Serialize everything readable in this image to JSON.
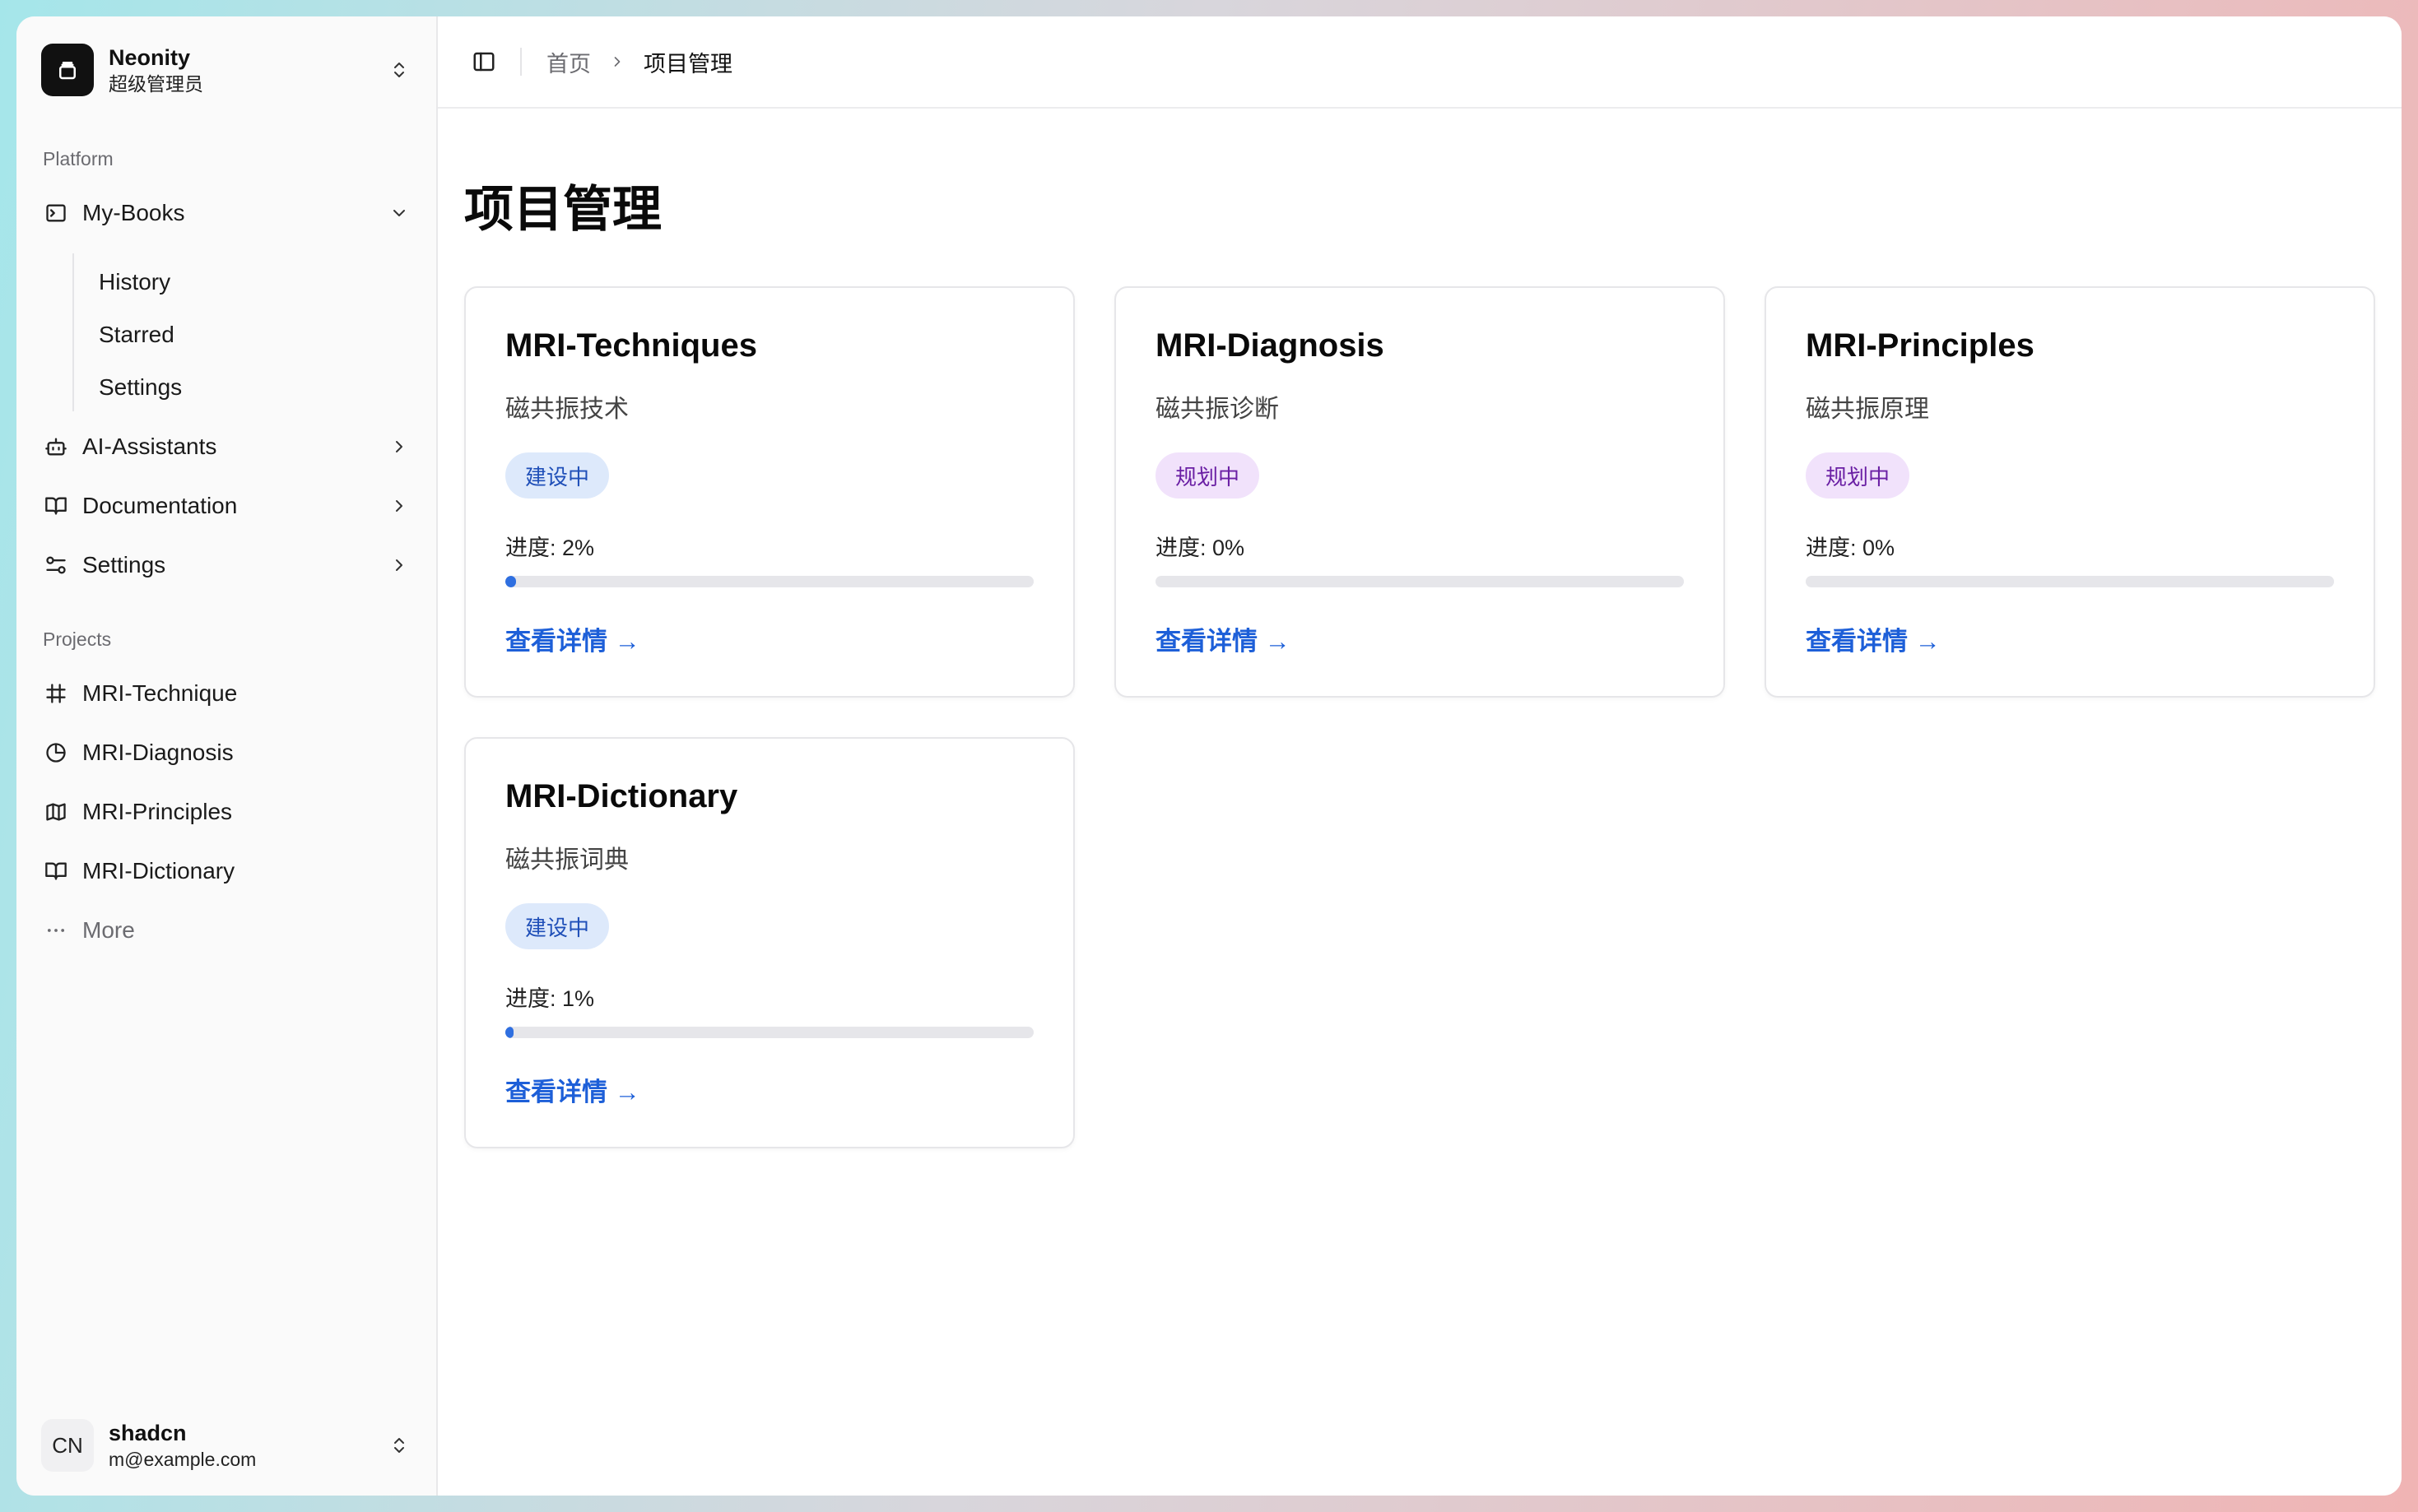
{
  "team": {
    "name": "Neonity",
    "role": "超级管理员"
  },
  "sidebar": {
    "platform_label": "Platform",
    "platform_items": [
      {
        "label": "My-Books",
        "icon": "terminal-icon",
        "expanded": true,
        "children": [
          {
            "label": "History"
          },
          {
            "label": "Starred"
          },
          {
            "label": "Settings"
          }
        ]
      },
      {
        "label": "AI-Assistants",
        "icon": "bot-icon"
      },
      {
        "label": "Documentation",
        "icon": "book-open-icon"
      },
      {
        "label": "Settings",
        "icon": "sliders-icon"
      }
    ],
    "projects_label": "Projects",
    "projects": [
      {
        "label": "MRI-Technique",
        "icon": "hash-frame-icon"
      },
      {
        "label": "MRI-Diagnosis",
        "icon": "pie-chart-icon"
      },
      {
        "label": "MRI-Principles",
        "icon": "map-icon"
      },
      {
        "label": "MRI-Dictionary",
        "icon": "book-open-icon"
      }
    ],
    "more_label": "More"
  },
  "user": {
    "initials": "CN",
    "name": "shadcn",
    "email": "m@example.com"
  },
  "breadcrumb": {
    "home": "首页",
    "current": "项目管理"
  },
  "page": {
    "title": "项目管理"
  },
  "cards": [
    {
      "title": "MRI-Techniques",
      "subtitle": "磁共振技术",
      "status": "建设中",
      "status_kind": "building",
      "progress_label": "进度: 2%",
      "progress": 0.02,
      "link": "查看详情 →"
    },
    {
      "title": "MRI-Diagnosis",
      "subtitle": "磁共振诊断",
      "status": "规划中",
      "status_kind": "planning",
      "progress_label": "进度: 0%",
      "progress": 0.0,
      "link": "查看详情 →"
    },
    {
      "title": "MRI-Principles",
      "subtitle": "磁共振原理",
      "status": "规划中",
      "status_kind": "planning",
      "progress_label": "进度: 0%",
      "progress": 0.0,
      "link": "查看详情 →"
    },
    {
      "title": "MRI-Dictionary",
      "subtitle": "磁共振词典",
      "status": "建设中",
      "status_kind": "building",
      "progress_label": "进度: 1%",
      "progress": 0.01,
      "link": "查看详情 →"
    }
  ],
  "colors": {
    "accent": "#1d5fd8",
    "progress_fill": "#2f6fe0",
    "building_bg": "#dde9fb",
    "planning_bg": "#f1e2fb"
  }
}
